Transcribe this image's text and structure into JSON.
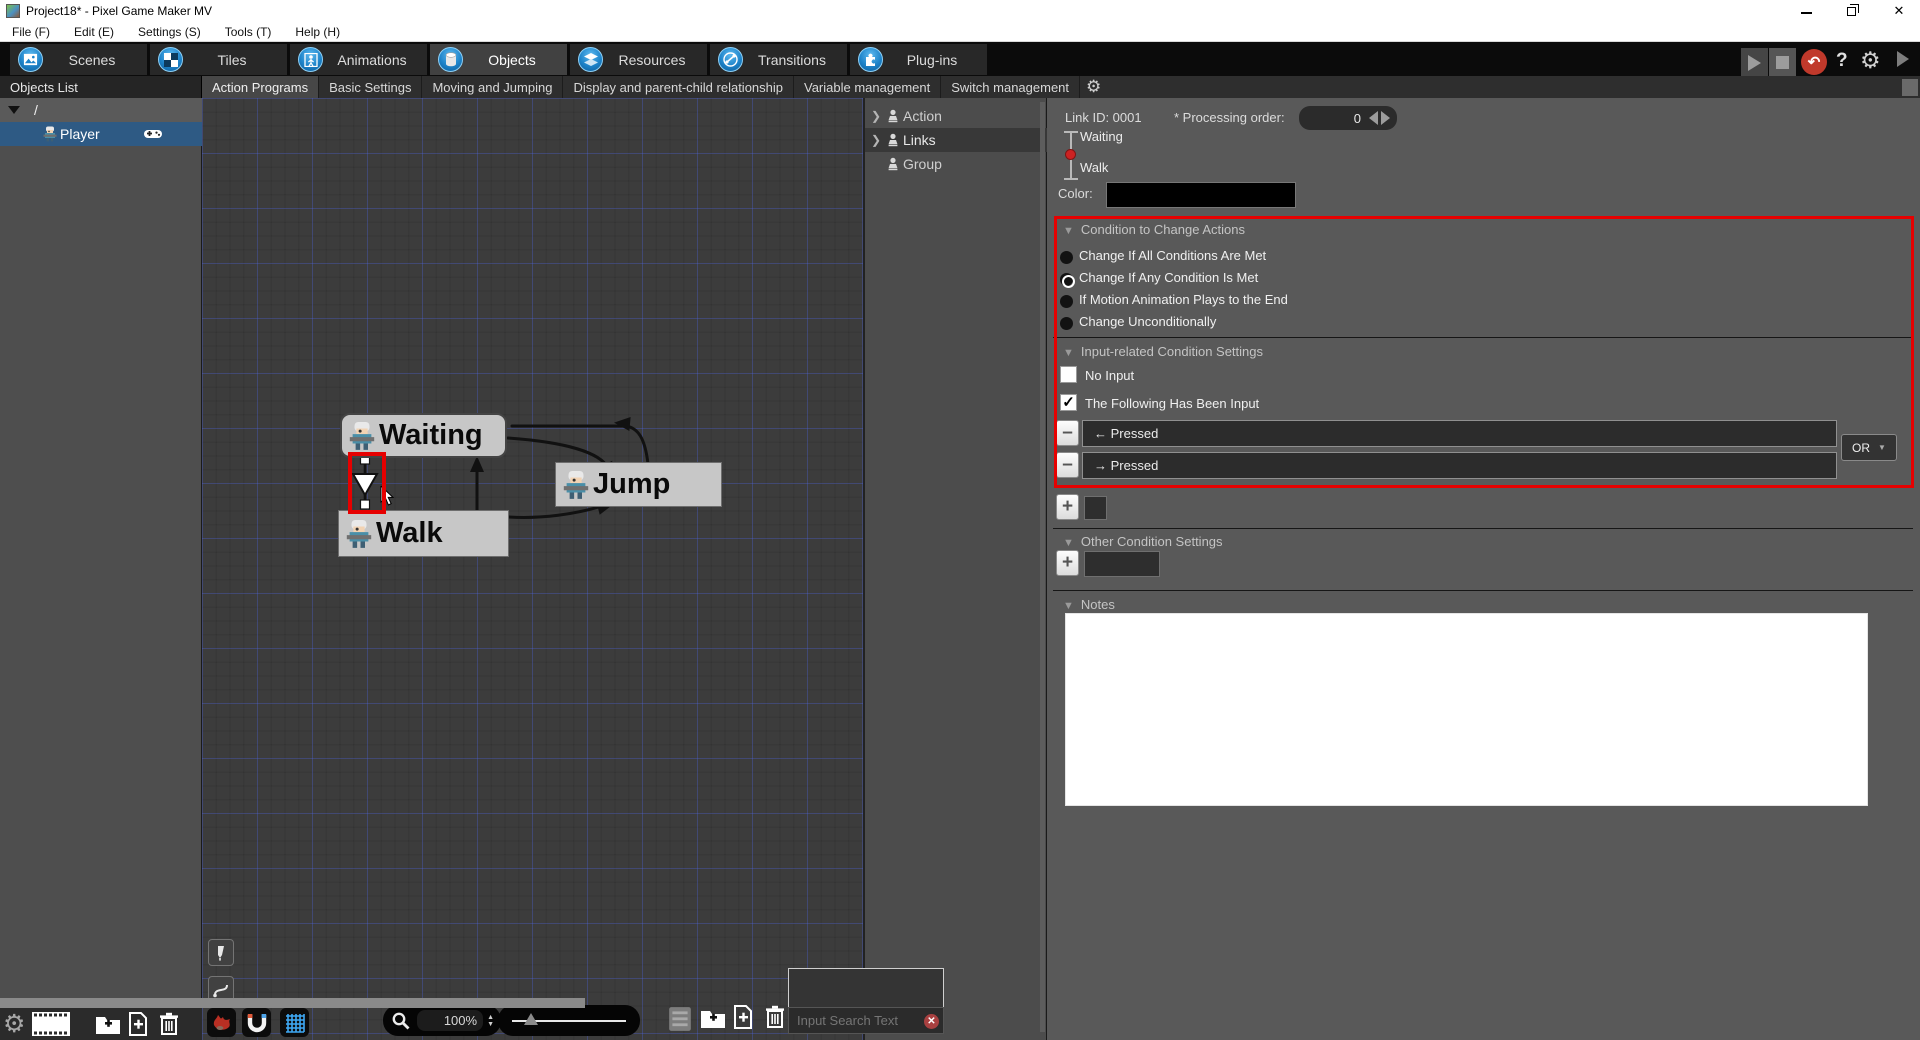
{
  "window": {
    "title": "Project18* - Pixel Game Maker MV"
  },
  "menu": {
    "items": [
      {
        "label": "File (F)"
      },
      {
        "label": "Edit (E)"
      },
      {
        "label": "Settings (S)"
      },
      {
        "label": "Tools (T)"
      },
      {
        "label": "Help (H)"
      }
    ]
  },
  "main_tabs": {
    "items": [
      {
        "label": "Scenes",
        "selected": false
      },
      {
        "label": "Tiles",
        "selected": false
      },
      {
        "label": "Animations",
        "selected": false
      },
      {
        "label": "Objects",
        "selected": true
      },
      {
        "label": "Resources",
        "selected": false
      },
      {
        "label": "Transitions",
        "selected": false
      },
      {
        "label": "Plug-ins",
        "selected": false
      }
    ]
  },
  "playback": {
    "help_label": "?"
  },
  "subtabs": {
    "items": [
      {
        "label": "Action Programs",
        "selected": true
      },
      {
        "label": "Basic Settings",
        "selected": false
      },
      {
        "label": "Moving and Jumping",
        "selected": false
      },
      {
        "label": "Display and parent-child relationship",
        "selected": false
      },
      {
        "label": "Variable management",
        "selected": false
      },
      {
        "label": "Switch management",
        "selected": false
      }
    ]
  },
  "objects_list": {
    "header": "Objects List",
    "root_label": "/",
    "player_label": "Player"
  },
  "canvas": {
    "nodes": {
      "waiting": "Waiting",
      "jump": "Jump",
      "walk": "Walk"
    },
    "zoom_value": "100%",
    "search_placeholder": "Input Search Text"
  },
  "tree": {
    "items": [
      {
        "label": "Action",
        "selected": false
      },
      {
        "label": "Links",
        "selected": true
      },
      {
        "label": "Group",
        "selected": false
      }
    ]
  },
  "inspector": {
    "link_id": "Link ID: 0001",
    "processing_order_label": "* Processing order:",
    "processing_order_value": "0",
    "link_from": "Waiting",
    "link_to": "Walk",
    "color_label": "Color:",
    "condition_section": {
      "title": "Condition to Change Actions",
      "options": [
        {
          "label": "Change If All Conditions Are Met",
          "selected": false
        },
        {
          "label": "Change If Any Condition Is Met",
          "selected": true
        },
        {
          "label": "If Motion Animation Plays to the End",
          "selected": false
        },
        {
          "label": "Change Unconditionally",
          "selected": false
        }
      ]
    },
    "input_section": {
      "title": "Input-related Condition Settings",
      "checkboxes": [
        {
          "label": "No Input",
          "checked": false,
          "mark": ""
        },
        {
          "label": "The Following Has Been Input",
          "checked": true,
          "mark": "✓"
        }
      ],
      "rows": [
        {
          "label": "← Pressed"
        },
        {
          "label": "→ Pressed"
        }
      ],
      "operator": "OR"
    },
    "other_section": {
      "title": "Other Condition Settings"
    },
    "notes_section": {
      "title": "Notes",
      "value": ""
    }
  },
  "colors": {
    "accent_blue": "#1d83c9",
    "selection_blue": "#2e5a84",
    "highlight_red": "#e60000",
    "grid_blue": "#5569d7",
    "node_gray": "#c7c7c7",
    "panel_gray": "#595959",
    "swatch_black": "#000000"
  }
}
